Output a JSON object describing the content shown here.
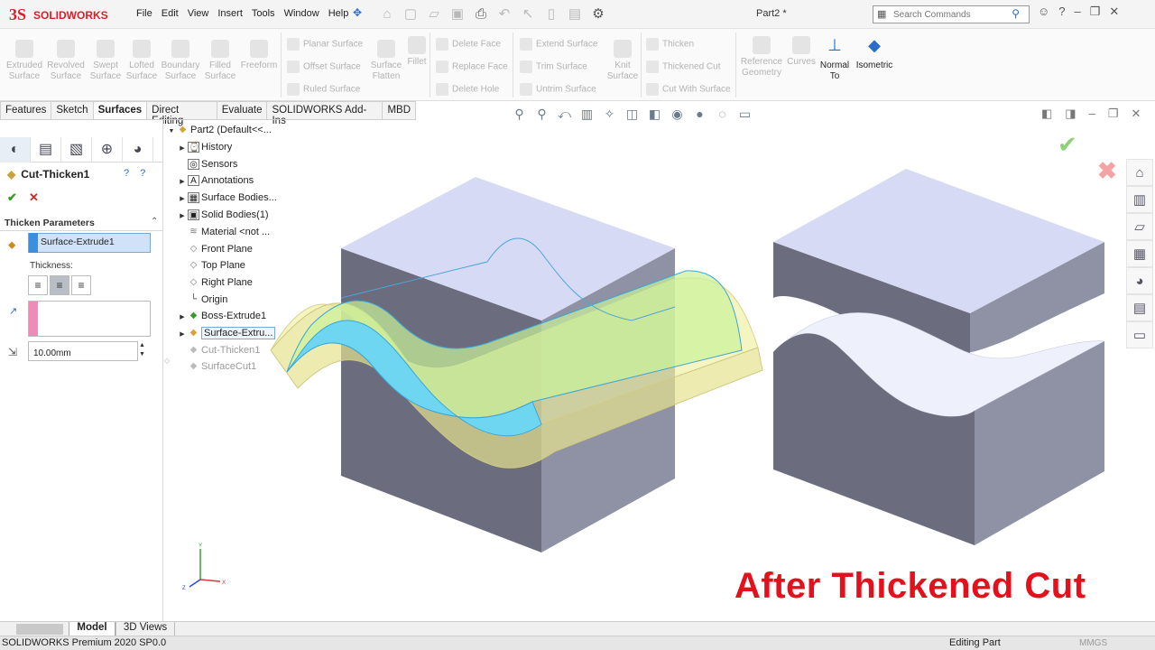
{
  "app": {
    "brand": "SOLIDWORKS",
    "document_title": "Part2 *",
    "menu": [
      "File",
      "Edit",
      "View",
      "Insert",
      "Tools",
      "Window",
      "Help"
    ],
    "search_placeholder": "Search Commands"
  },
  "ribbon": {
    "large_buttons": [
      {
        "label_1": "Extruded",
        "label_2": "Surface"
      },
      {
        "label_1": "Revolved",
        "label_2": "Surface"
      },
      {
        "label_1": "Swept",
        "label_2": "Surface"
      },
      {
        "label_1": "Lofted",
        "label_2": "Surface"
      },
      {
        "label_1": "Boundary",
        "label_2": "Surface"
      },
      {
        "label_1": "Filled",
        "label_2": "Surface"
      },
      {
        "label_1": "Freeform",
        "label_2": ""
      }
    ],
    "small_col_1": [
      "Planar Surface",
      "Offset Surface",
      "Ruled Surface"
    ],
    "surface_flatten": {
      "label_1": "Surface",
      "label_2": "Flatten"
    },
    "fillet": "Fillet",
    "small_col_2": [
      "Delete Face",
      "Replace Face",
      "Delete Hole"
    ],
    "small_col_3": [
      "Extend Surface",
      "Trim Surface",
      "Untrim Surface"
    ],
    "knit": {
      "label_1": "Knit",
      "label_2": "Surface"
    },
    "small_col_4": [
      "Thicken",
      "Thickened Cut",
      "Cut With Surface"
    ],
    "reference_geometry": {
      "label_1": "Reference",
      "label_2": "Geometry"
    },
    "curves": "Curves",
    "normal_to": {
      "label_1": "Normal",
      "label_2": "To"
    },
    "isometric": "Isometric"
  },
  "tabs": [
    "Features",
    "Sketch",
    "Surfaces",
    "Direct Editing",
    "Evaluate",
    "SOLIDWORKS Add-Ins",
    "MBD"
  ],
  "property_manager": {
    "title": "Cut-Thicken1",
    "group_title": "Thicken Parameters",
    "selected_surface": "Surface-Extrude1",
    "thickness_label": "Thickness:",
    "thickness_value": "10.00mm"
  },
  "feature_tree": {
    "root": "Part2  (Default<<...",
    "items": [
      {
        "label": "History",
        "icon": "history-icon"
      },
      {
        "label": "Sensors",
        "icon": "sensors-icon"
      },
      {
        "label": "Annotations",
        "icon": "annotations-icon"
      },
      {
        "label": "Surface Bodies...",
        "icon": "surface-bodies-icon"
      },
      {
        "label": "Solid Bodies(1)",
        "icon": "solid-bodies-icon"
      },
      {
        "label": "Material <not ...",
        "icon": "material-icon"
      },
      {
        "label": "Front Plane",
        "icon": "plane-icon"
      },
      {
        "label": "Top Plane",
        "icon": "plane-icon"
      },
      {
        "label": "Right Plane",
        "icon": "plane-icon"
      },
      {
        "label": "Origin",
        "icon": "origin-icon"
      },
      {
        "label": "Boss-Extrude1",
        "icon": "boss-extrude-icon"
      },
      {
        "label": "Surface-Extru...",
        "icon": "surface-extrude-icon"
      },
      {
        "label": "Cut-Thicken1",
        "icon": "cut-thicken-icon"
      },
      {
        "label": "SurfaceCut1",
        "icon": "surface-cut-icon"
      }
    ]
  },
  "viewport": {
    "overlay_text": "After Thickened Cut",
    "triad": {
      "x": "X",
      "y": "Y",
      "z": "Z"
    }
  },
  "bottom_tabs": [
    "Model",
    "3D Views"
  ],
  "status": {
    "left": "SOLIDWORKS Premium 2020 SP0.0",
    "mode": "Editing Part",
    "units": "MMGS"
  },
  "colors": {
    "accent_blue": "#2a6bc9",
    "overlay_red": "#e3111b",
    "block_top": "#d6daf4",
    "block_front": "#6b6d7e",
    "block_side": "#8f92a4"
  }
}
